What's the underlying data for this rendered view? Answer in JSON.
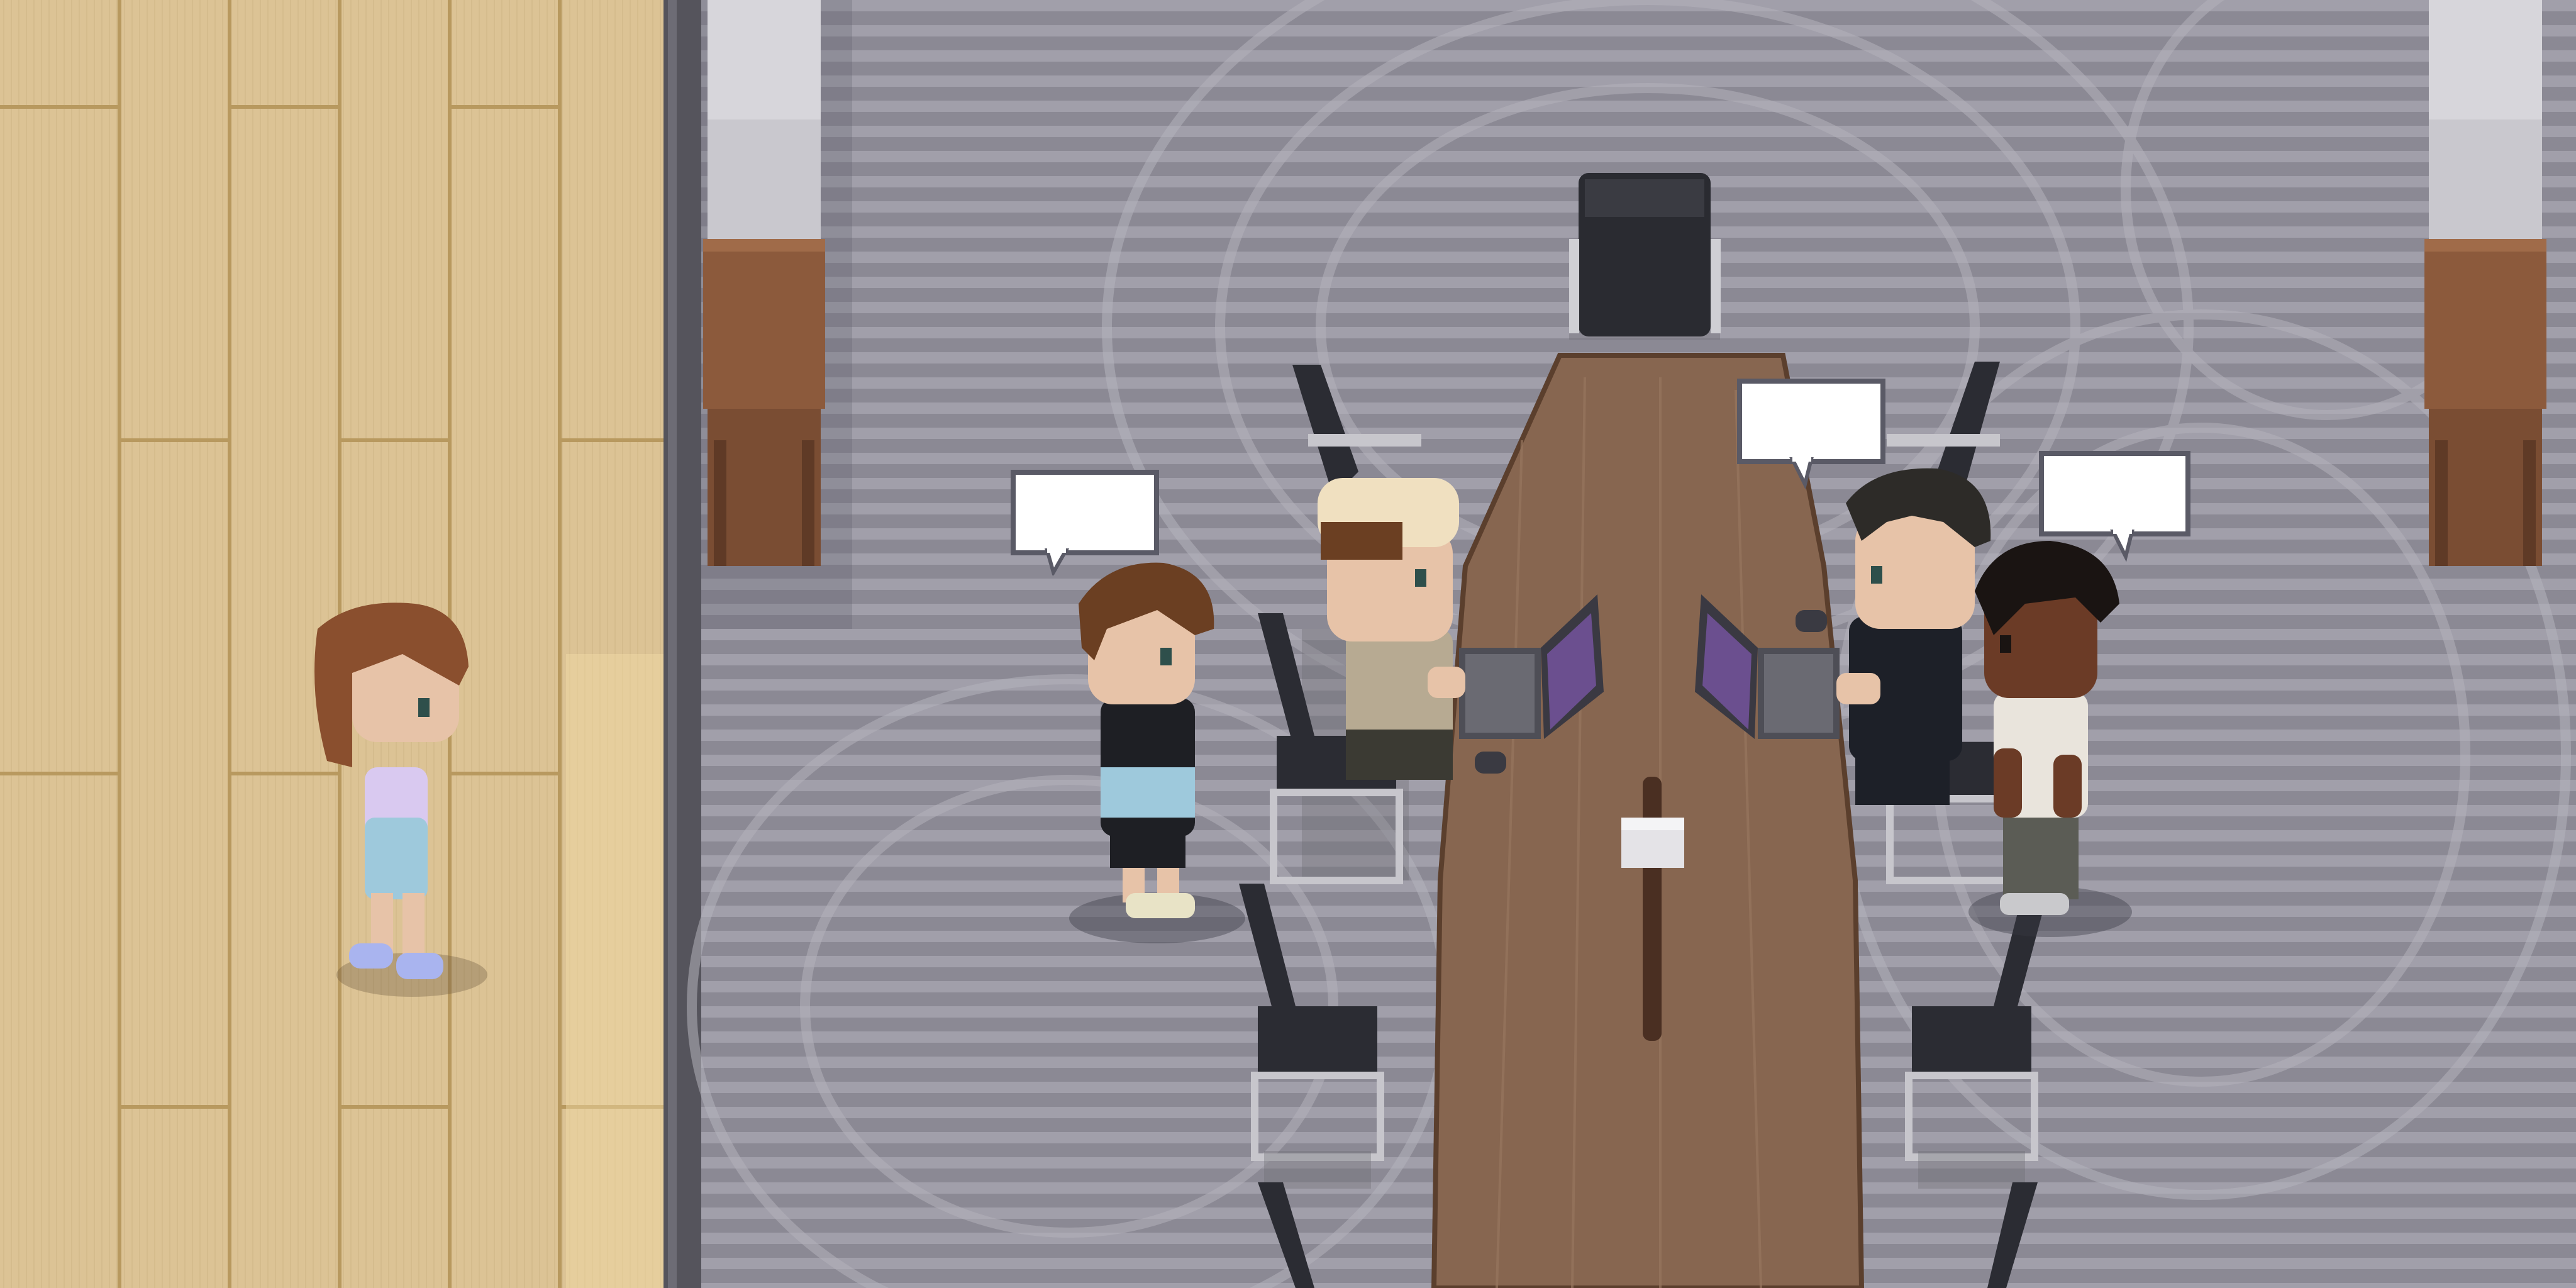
{
  "scene": {
    "name": "office-meeting-room",
    "left_area": "hallway-wood-floor",
    "right_area": "meeting-room-carpet",
    "colors": {
      "wood_light": "#e2c99a",
      "wood_dark": "#c9ad7e",
      "wall": "#5e5d66",
      "carpet_base": "#8d8b96",
      "carpet_stripe": "#a3a1ab",
      "table": "#8a6a50",
      "chair": "#2b2c33"
    }
  },
  "characters": [
    {
      "id": "woman-hallway",
      "hair": "#8a4f2e",
      "shirt": "#d9c9f0",
      "pants": "#9ec9dc"
    },
    {
      "id": "boy-standing",
      "hair": "#6b3f22",
      "shirt": "#1e1f24",
      "pants": "#1e1f24"
    },
    {
      "id": "man-cap-laptop",
      "hair": "#f0e0c0",
      "shirt": "#b7aa92",
      "pants": "#3b3a33"
    },
    {
      "id": "man-suit-laptop",
      "hair": "#2d2b28",
      "shirt": "#1d2028",
      "pants": "#1d2028"
    },
    {
      "id": "man-white-shirt",
      "hair": "#1a1412",
      "shirt": "#e9e4dc",
      "pants": "#5b5c55"
    }
  ],
  "speech_bubbles": [
    {
      "id": "bubble-boy",
      "text": ""
    },
    {
      "id": "bubble-suit",
      "text": ""
    },
    {
      "id": "bubble-white-shirt",
      "text": ""
    }
  ]
}
